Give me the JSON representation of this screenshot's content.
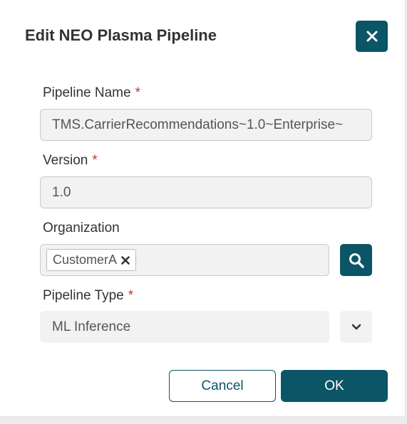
{
  "dialog": {
    "title": "Edit NEO Plasma Pipeline",
    "close_icon": "close-icon"
  },
  "fields": {
    "pipeline_name": {
      "label": "Pipeline Name",
      "required_mark": "*",
      "value": "TMS.CarrierRecommendations~1.0~Enterprise~"
    },
    "version": {
      "label": "Version",
      "required_mark": "*",
      "value": "1.0"
    },
    "organization": {
      "label": "Organization",
      "chips": [
        {
          "label": "CustomerA",
          "remove_icon": "remove-x-icon"
        }
      ],
      "search_icon": "search-icon"
    },
    "pipeline_type": {
      "label": "Pipeline Type",
      "required_mark": "*",
      "selected": "ML Inference",
      "dropdown_icon": "chevron-down-icon"
    }
  },
  "buttons": {
    "cancel": "Cancel",
    "ok": "OK"
  },
  "colors": {
    "primary": "#0b5566",
    "required": "#c0392b",
    "field_bg": "#f2f2f2"
  }
}
